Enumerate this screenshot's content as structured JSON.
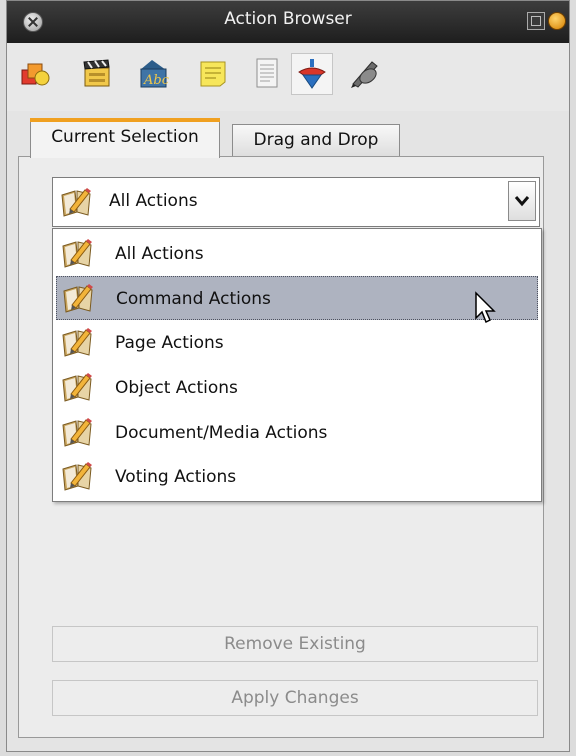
{
  "window": {
    "title": "Action Browser"
  },
  "toolbar": {
    "tools": [
      {
        "icon": "shapes-icon"
      },
      {
        "icon": "clapperboard-icon"
      },
      {
        "icon": "text-image-icon"
      },
      {
        "icon": "sticky-note-icon"
      },
      {
        "icon": "document-icon"
      },
      {
        "icon": "spinning-top-icon",
        "active": true
      },
      {
        "icon": "stylus-icon"
      }
    ]
  },
  "tabs": {
    "current": "Current Selection",
    "drag": "Drag and Drop"
  },
  "combo": {
    "selected": "All Actions"
  },
  "dropdown": {
    "items": [
      {
        "label": "All Actions"
      },
      {
        "label": "Command Actions",
        "highlighted": true
      },
      {
        "label": "Page Actions"
      },
      {
        "label": "Object Actions"
      },
      {
        "label": "Document/Media Actions"
      },
      {
        "label": "Voting Actions"
      }
    ]
  },
  "buttons": {
    "remove": "Remove Existing",
    "apply": "Apply Changes"
  },
  "colors": {
    "titlebar": "#2a2a2a",
    "tab_accent": "#f0a020",
    "highlight": "#aeb3c0"
  }
}
